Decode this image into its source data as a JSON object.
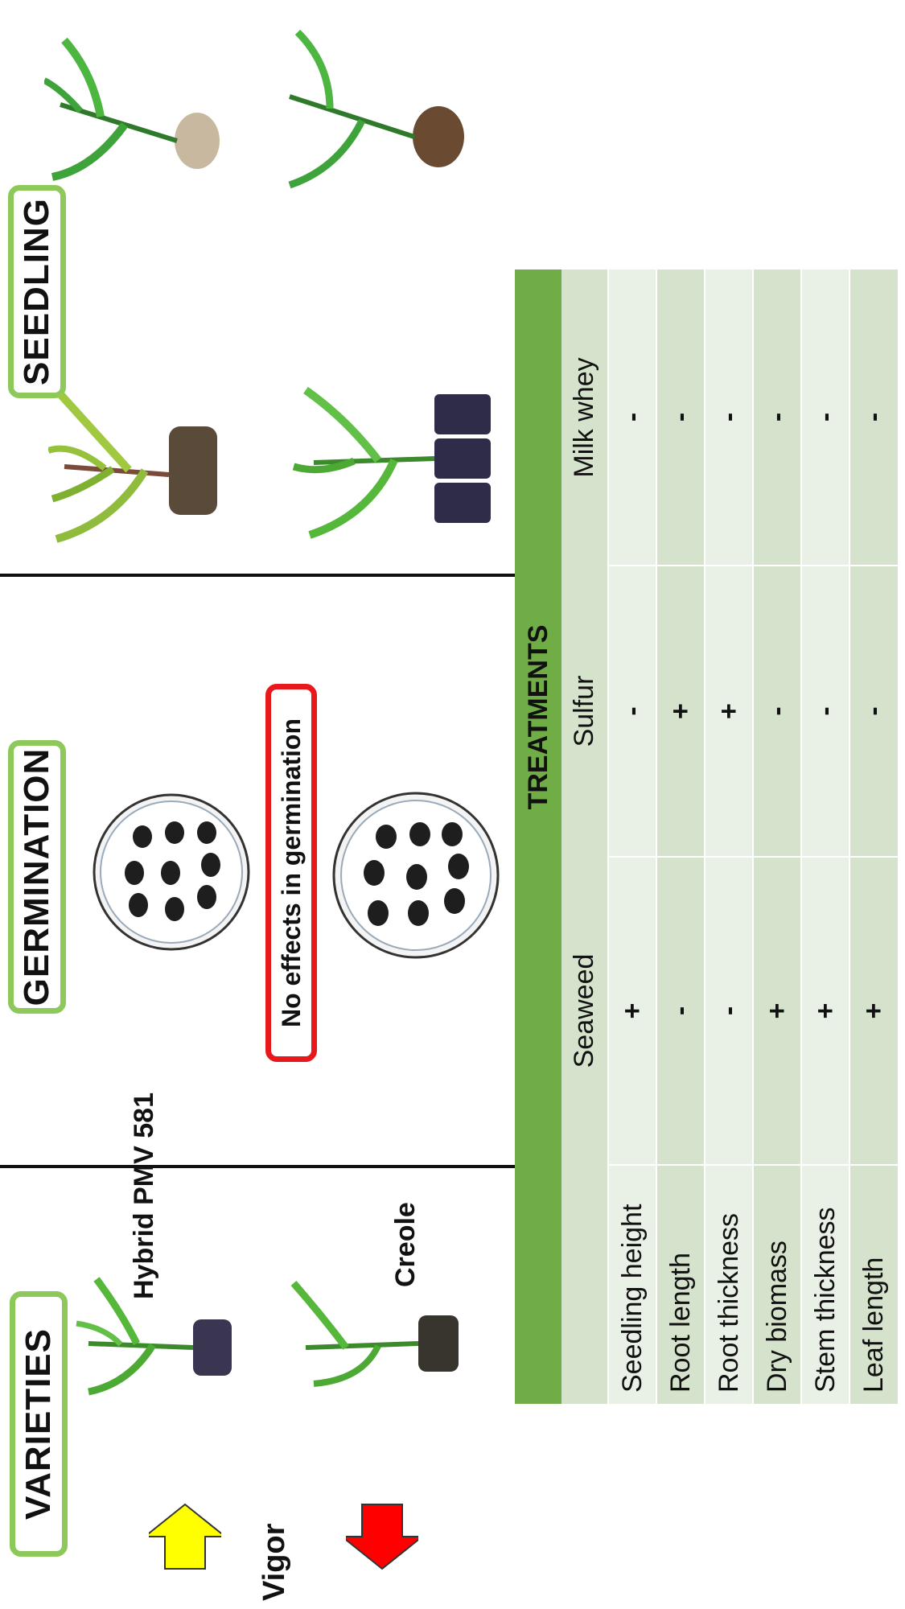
{
  "sections": {
    "varieties": "VARIETIES",
    "germination": "GERMINATION",
    "seedling": "SEEDLING"
  },
  "varieties": {
    "hybrid": "Hybrid PMV 581",
    "creole": "Creole",
    "vigor": "Vigor"
  },
  "germination_note": "No effects in germination",
  "table": {
    "title": "TREATMENTS",
    "columns": [
      "Seaweed",
      "Sulfur",
      "Milk whey"
    ],
    "rows": [
      {
        "label": "Seedling height",
        "values": [
          "+",
          "-",
          "-"
        ]
      },
      {
        "label": "Root length",
        "values": [
          "-",
          "+",
          "-"
        ]
      },
      {
        "label": "Root thickness",
        "values": [
          "-",
          "+",
          "-"
        ]
      },
      {
        "label": "Dry biomass",
        "values": [
          "+",
          "-",
          "-"
        ]
      },
      {
        "label": "Stem thickness",
        "values": [
          "+",
          "-",
          "-"
        ]
      },
      {
        "label": "Leaf length",
        "values": [
          "+",
          "-",
          "-"
        ]
      }
    ]
  },
  "colors": {
    "box_border": "#8dc85a",
    "note_border": "#e8191c",
    "header_green": "#70ad47",
    "arrow_up": "#ffff00",
    "arrow_down": "#ff0000"
  }
}
